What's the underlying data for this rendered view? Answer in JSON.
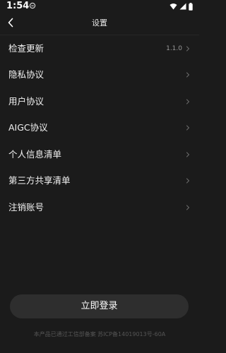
{
  "status_bar": {
    "time": "1:54",
    "icons": [
      "notification-icon",
      "wifi-icon",
      "signal-icon",
      "battery-icon"
    ]
  },
  "header": {
    "title": "设置",
    "back_icon": "chevron-left-icon"
  },
  "settings": {
    "items": [
      {
        "label": "检查更新",
        "value": "1.1.0"
      },
      {
        "label": "隐私协议"
      },
      {
        "label": "用户协议"
      },
      {
        "label": "AIGC协议"
      },
      {
        "label": "个人信息清单"
      },
      {
        "label": "第三方共享清单"
      },
      {
        "label": "注销账号"
      }
    ]
  },
  "login": {
    "label": "立即登录"
  },
  "footer": {
    "icp": "本产品已通过工信部备案  苏ICP备14019013号-60A"
  },
  "colors": {
    "background": "#1b1b1b",
    "button": "#2e2e2e",
    "text": "#f2f2f2",
    "muted": "#9a9a9a",
    "footer": "#555555"
  }
}
